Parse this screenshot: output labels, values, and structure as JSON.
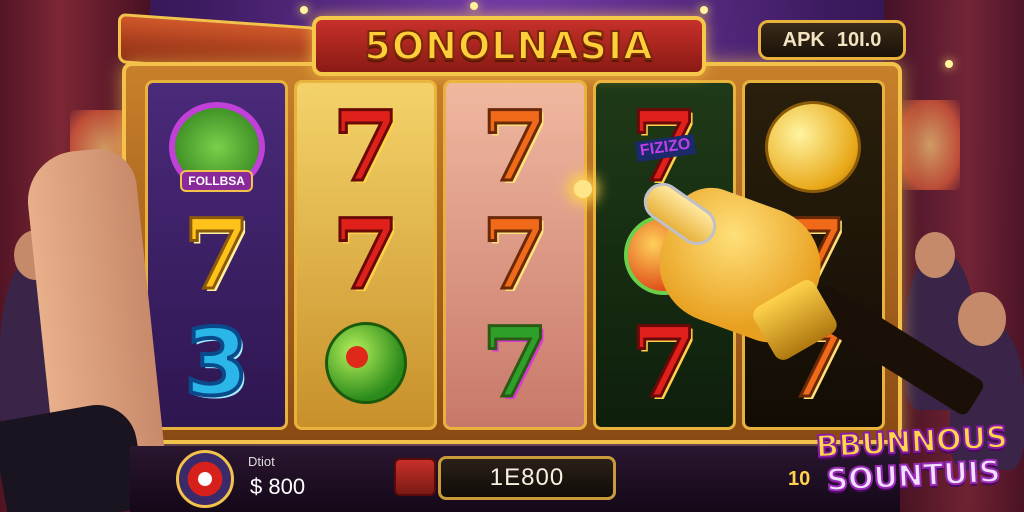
{
  "game": {
    "title": "SONOLNASIA",
    "title_display": "5ONOLNASIA",
    "apk_label": "APK",
    "apk_value": "10I.0"
  },
  "reels": [
    {
      "symbols": [
        {
          "type": "emblem",
          "label": "FOLLBSA"
        },
        {
          "type": "seven",
          "style": "gold"
        },
        {
          "type": "three",
          "style": "blue"
        }
      ]
    },
    {
      "symbols": [
        {
          "type": "seven",
          "style": "red"
        },
        {
          "type": "seven",
          "style": "red"
        },
        {
          "type": "melon"
        }
      ]
    },
    {
      "symbols": [
        {
          "type": "seven",
          "style": "orange"
        },
        {
          "type": "seven",
          "style": "orange"
        },
        {
          "type": "seven",
          "style": "striped"
        }
      ]
    },
    {
      "symbols": [
        {
          "type": "seven",
          "style": "red",
          "tag": "FIZIZO"
        },
        {
          "type": "orange"
        },
        {
          "type": "seven",
          "style": "red"
        }
      ]
    },
    {
      "symbols": [
        {
          "type": "coin"
        },
        {
          "type": "seven",
          "style": "orange"
        },
        {
          "type": "seven",
          "style": "orange"
        }
      ]
    }
  ],
  "bottom_bar": {
    "bet_label": "Dtiot",
    "bet_value": "$ 800",
    "credit_value": "1E800",
    "line_value": "10"
  },
  "bonus_logo": {
    "line1": "BBUNNOUS",
    "line2": "SOUNTUIS"
  },
  "colors": {
    "gold_frame": "#f2c24a",
    "title_red": "#c8302a",
    "seven_red": "#e0201a"
  }
}
